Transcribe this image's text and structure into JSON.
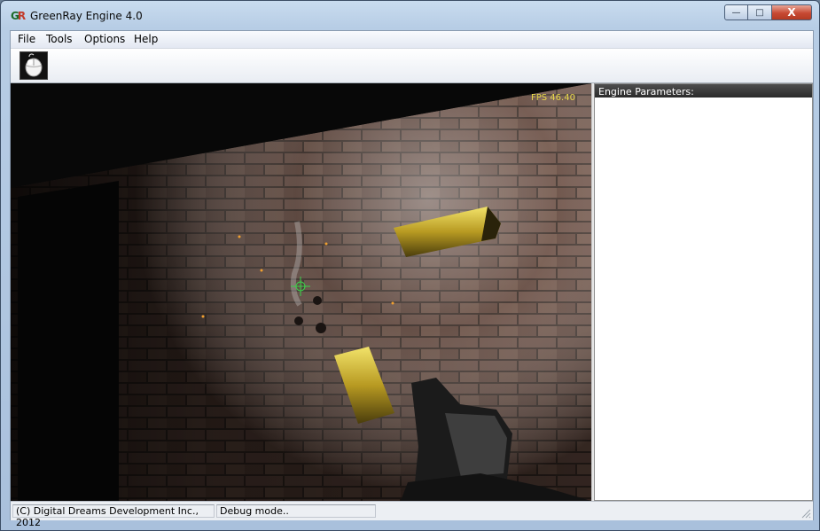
{
  "window": {
    "title": "GreenRay Engine 4.0",
    "logo_text_a": "G",
    "logo_text_b": "R",
    "minimize_label": "—",
    "maximize_label": "□",
    "close_label": "X"
  },
  "menu": {
    "items": [
      {
        "label": "File"
      },
      {
        "label": "Tools"
      },
      {
        "label": "Options"
      },
      {
        "label": "Help"
      }
    ]
  },
  "toolbar": {
    "tools": [
      {
        "icon": "mouse-icon"
      }
    ]
  },
  "viewport": {
    "fps_text": "FPS 46.40"
  },
  "params_panel": {
    "header": "Engine Parameters:"
  },
  "status": {
    "copyright": "(C) Digital Dreams Development Inc., 2012",
    "mode": "Debug mode.."
  },
  "colors": {
    "fps_text": "#e8d84a",
    "panel_header": "#3a3a3a",
    "brass": "#c8b23a"
  }
}
